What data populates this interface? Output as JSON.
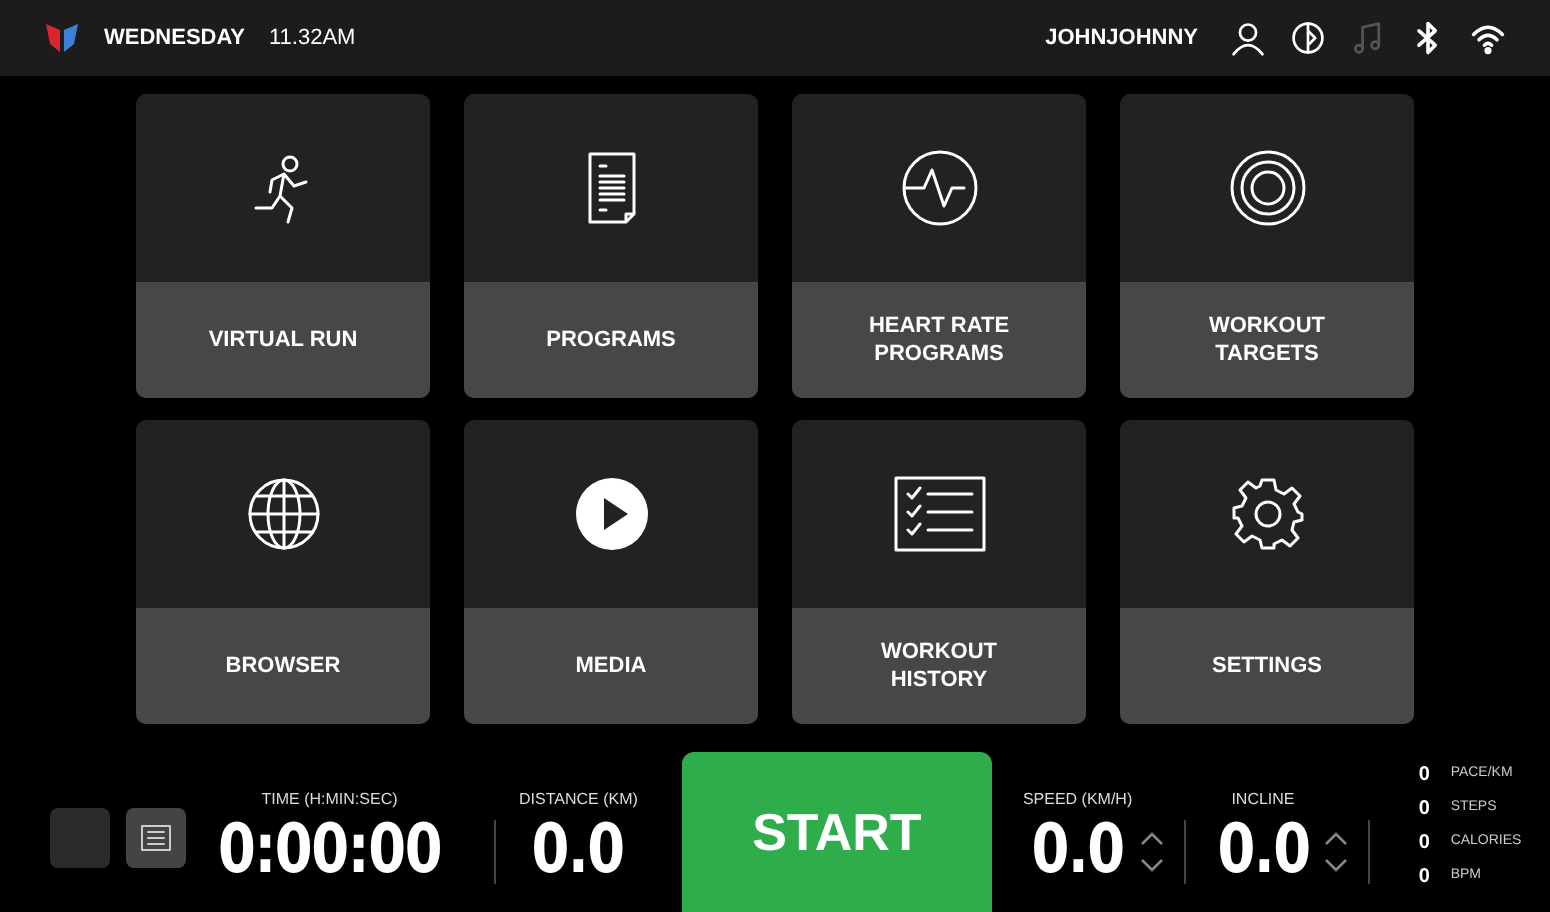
{
  "top_bar": {
    "day": "WEDNESDAY",
    "time": "11.32AM",
    "user": "JOHNJOHNNY",
    "status_icons": [
      {
        "kind": "user",
        "dimmed": false
      },
      {
        "kind": "sound",
        "dimmed": false
      },
      {
        "kind": "music",
        "dimmed": true
      },
      {
        "kind": "bluetooth",
        "dimmed": false
      },
      {
        "kind": "wifi",
        "dimmed": false
      }
    ]
  },
  "tiles": [
    {
      "kind": "run",
      "label": "VIRTUAL RUN"
    },
    {
      "kind": "document",
      "label": "PROGRAMS"
    },
    {
      "kind": "heart",
      "label": "HEART RATE PROGRAMS"
    },
    {
      "kind": "target",
      "label": "WORKOUT TARGETS"
    },
    {
      "kind": "globe",
      "label": "BROWSER"
    },
    {
      "kind": "play",
      "label": "MEDIA"
    },
    {
      "kind": "checklist",
      "label": "WORKOUT HISTORY"
    },
    {
      "kind": "gear",
      "label": "SETTINGS"
    }
  ],
  "console": {
    "time": {
      "label": "TIME (H:MIN:SEC)",
      "value": "0:00:00"
    },
    "distance": {
      "label": "DISTANCE (KM)",
      "value": "0.0"
    },
    "start": "START",
    "speed": {
      "label": "SPEED (KM/H)",
      "value": "0.0"
    },
    "incline": {
      "label": "INCLINE",
      "value": "0.0"
    },
    "stats": [
      {
        "value": "0",
        "label": "PACE/KM"
      },
      {
        "value": "0",
        "label": "STEPS"
      },
      {
        "value": "0",
        "label": "CALORIES"
      },
      {
        "value": "0",
        "label": "BPM"
      }
    ]
  }
}
